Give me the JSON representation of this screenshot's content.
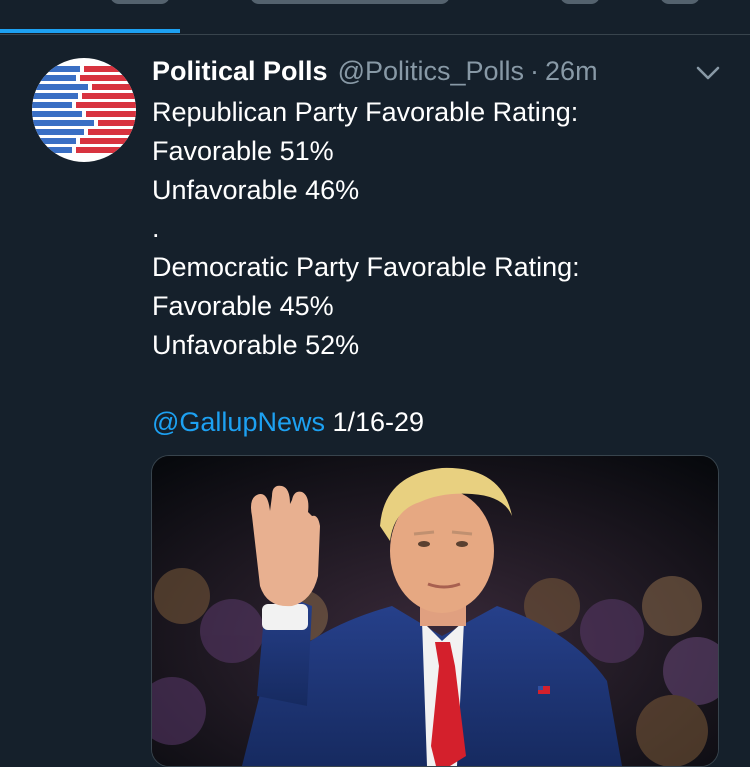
{
  "tweet": {
    "author_name": "Political Polls",
    "handle": "@Politics_Polls",
    "separator": "·",
    "time": "26m",
    "lines": [
      "Republican Party Favorable Rating:",
      "Favorable 51%",
      "Unfavorable 46%",
      ".",
      "Democratic Party Favorable Rating:",
      "Favorable 45%",
      "Unfavorable 52%",
      ""
    ],
    "mention": "@GallupNews",
    "date_range": " 1/16-29"
  },
  "icons": {
    "avatar": "poll-bars-logo",
    "menu": "chevron-down-icon"
  },
  "colors": {
    "background": "#15202b",
    "accent": "#1da1f2",
    "secondary_text": "#8899a6",
    "logo_blue": "#3a6fc4",
    "logo_red": "#d8333f"
  }
}
